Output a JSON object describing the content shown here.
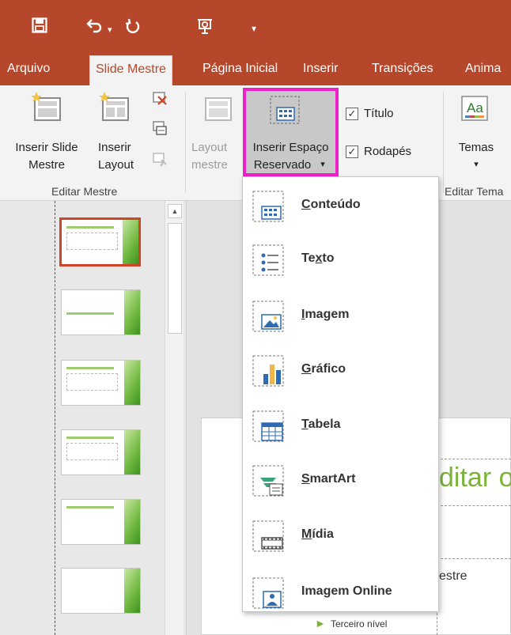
{
  "quick_access": {
    "save_icon": "save-icon",
    "undo_icon": "undo-icon",
    "undo_dropdown": "▾",
    "redo_icon": "redo-icon",
    "present_icon": "present-icon",
    "customize_icon": "▾"
  },
  "tabs": [
    {
      "label": "Arquivo"
    },
    {
      "label": "Slide Mestre",
      "active": true
    },
    {
      "label": "Página Inicial"
    },
    {
      "label": "Inserir"
    },
    {
      "label": "Transições"
    },
    {
      "label": "Anima"
    }
  ],
  "ribbon": {
    "insert_slide_master": {
      "line1": "Inserir Slide",
      "line2": "Mestre"
    },
    "insert_layout": {
      "line1": "Inserir",
      "line2": "Layout"
    },
    "group_edit_master": "Editar Mestre",
    "layout_master": {
      "line1": "Layout",
      "line2": "mestre"
    },
    "insert_placeholder": {
      "line1": "Inserir Espaço",
      "line2": "Reservado",
      "arrow": "▾"
    },
    "title_checkbox": {
      "label": "Título",
      "checked": "✓"
    },
    "footer_checkbox": {
      "label": "Rodapés",
      "checked": "✓"
    },
    "themes": {
      "label": "Temas",
      "arrow": "▾"
    },
    "group_edit_theme": "Editar Tema"
  },
  "placeholder_menu": [
    {
      "label": "Conteúdo",
      "hotkey": "C",
      "rest": "onteúdo",
      "icon": "content-placeholder-icon"
    },
    {
      "label": "Texto",
      "hotkey_pre": "Te",
      "hotkey": "x",
      "rest": "to",
      "icon": "text-placeholder-icon"
    },
    {
      "label": "Imagem",
      "hotkey": "I",
      "rest": "magem",
      "icon": "picture-placeholder-icon"
    },
    {
      "label": "Gráfico",
      "hotkey": "G",
      "rest": "ráfico",
      "icon": "chart-placeholder-icon"
    },
    {
      "label": "Tabela",
      "hotkey": "T",
      "rest": "abela",
      "icon": "table-placeholder-icon"
    },
    {
      "label": "SmartArt",
      "hotkey": "S",
      "rest": "martArt",
      "icon": "smartart-placeholder-icon"
    },
    {
      "label": "Mídia",
      "hotkey": "M",
      "rest": "ídia",
      "icon": "media-placeholder-icon"
    },
    {
      "label": "Imagem Online",
      "hotkey": "",
      "rest": "Imagem Online",
      "icon": "online-picture-placeholder-icon"
    }
  ],
  "slide": {
    "title_fragment": "ditar o",
    "body_fragment": "estre",
    "sub_fragment": "Terceiro nível"
  },
  "colors": {
    "brand": "#b7472a",
    "highlight": "#f020c8",
    "accent_green": "#7ab338"
  }
}
